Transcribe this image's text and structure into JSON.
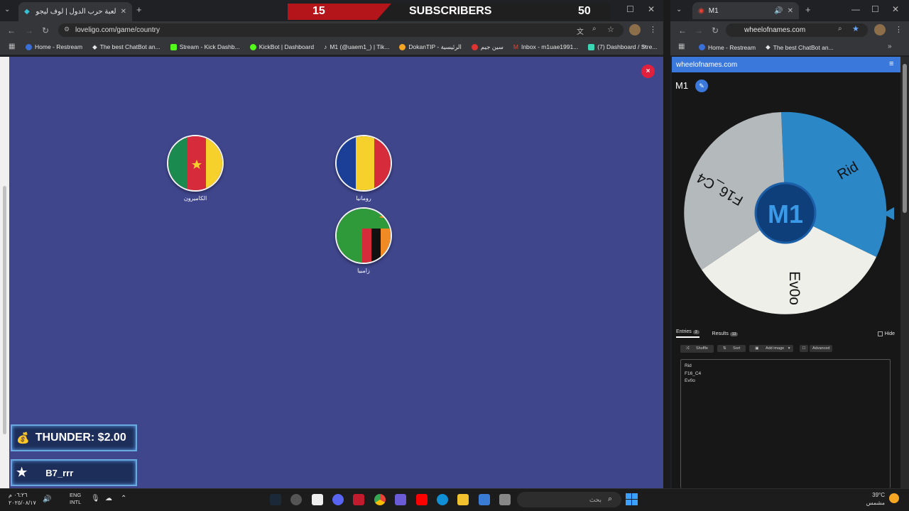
{
  "left_browser": {
    "tab_title": "لعبة حرب الدول | لوف ليجو يوفر",
    "url": "loveligo.com/game/country",
    "bookmarks": [
      "Home - Restream",
      "The best ChatBot an...",
      "Stream - Kick Dashb...",
      "KickBot | Dashboard",
      "M1 (@uaem1_) | Tik...",
      "DokanTIP - الرئيسية",
      "سين جيم",
      "Inbox - m1uae1991...",
      "(7) Dashboard / Stre..."
    ],
    "close_label": "×",
    "countries": [
      {
        "name": "الكاميرون",
        "flag": "cameroon"
      },
      {
        "name": "رومانيا",
        "flag": "romania"
      },
      {
        "name": "زامبيا",
        "flag": "zambia"
      }
    ]
  },
  "overlay": {
    "current": "15",
    "label": "SUBSCRIBERS",
    "goal": "50",
    "alert1": "THUNDER: $2.00",
    "alert2": "B7_rrr"
  },
  "right_browser": {
    "tab_title": "M1",
    "url": "wheelofnames.com",
    "bookmarks": [
      "Home - Restream",
      "The best ChatBot an..."
    ],
    "site_name": "wheelofnames.com",
    "wheel_title": "M1",
    "wheel_center_text": "M1",
    "wheel_entries": [
      {
        "label": "Rid",
        "color": "#2b87c6"
      },
      {
        "label": "Ev0o",
        "color": "#efefe9"
      },
      {
        "label": "F16_C4",
        "color": "#b4b9bc"
      }
    ],
    "tabs": {
      "entries": "Entries",
      "entries_count": "3",
      "results": "Results",
      "results_count": "13",
      "hide": "Hide"
    },
    "tools": [
      "Shuffle",
      "Sort",
      "Add image",
      "Advanced"
    ],
    "entries_text": [
      "Rid",
      "F16_C4",
      "Ev0o"
    ]
  },
  "taskbar": {
    "time": "٠٦:٢٦ م",
    "date": "٢٠٢٥/٠٨/١٧",
    "lang": "ENG",
    "lang2": "INTL",
    "search_placeholder": "بحث",
    "temp": "39°C",
    "weather": "مشمس"
  }
}
